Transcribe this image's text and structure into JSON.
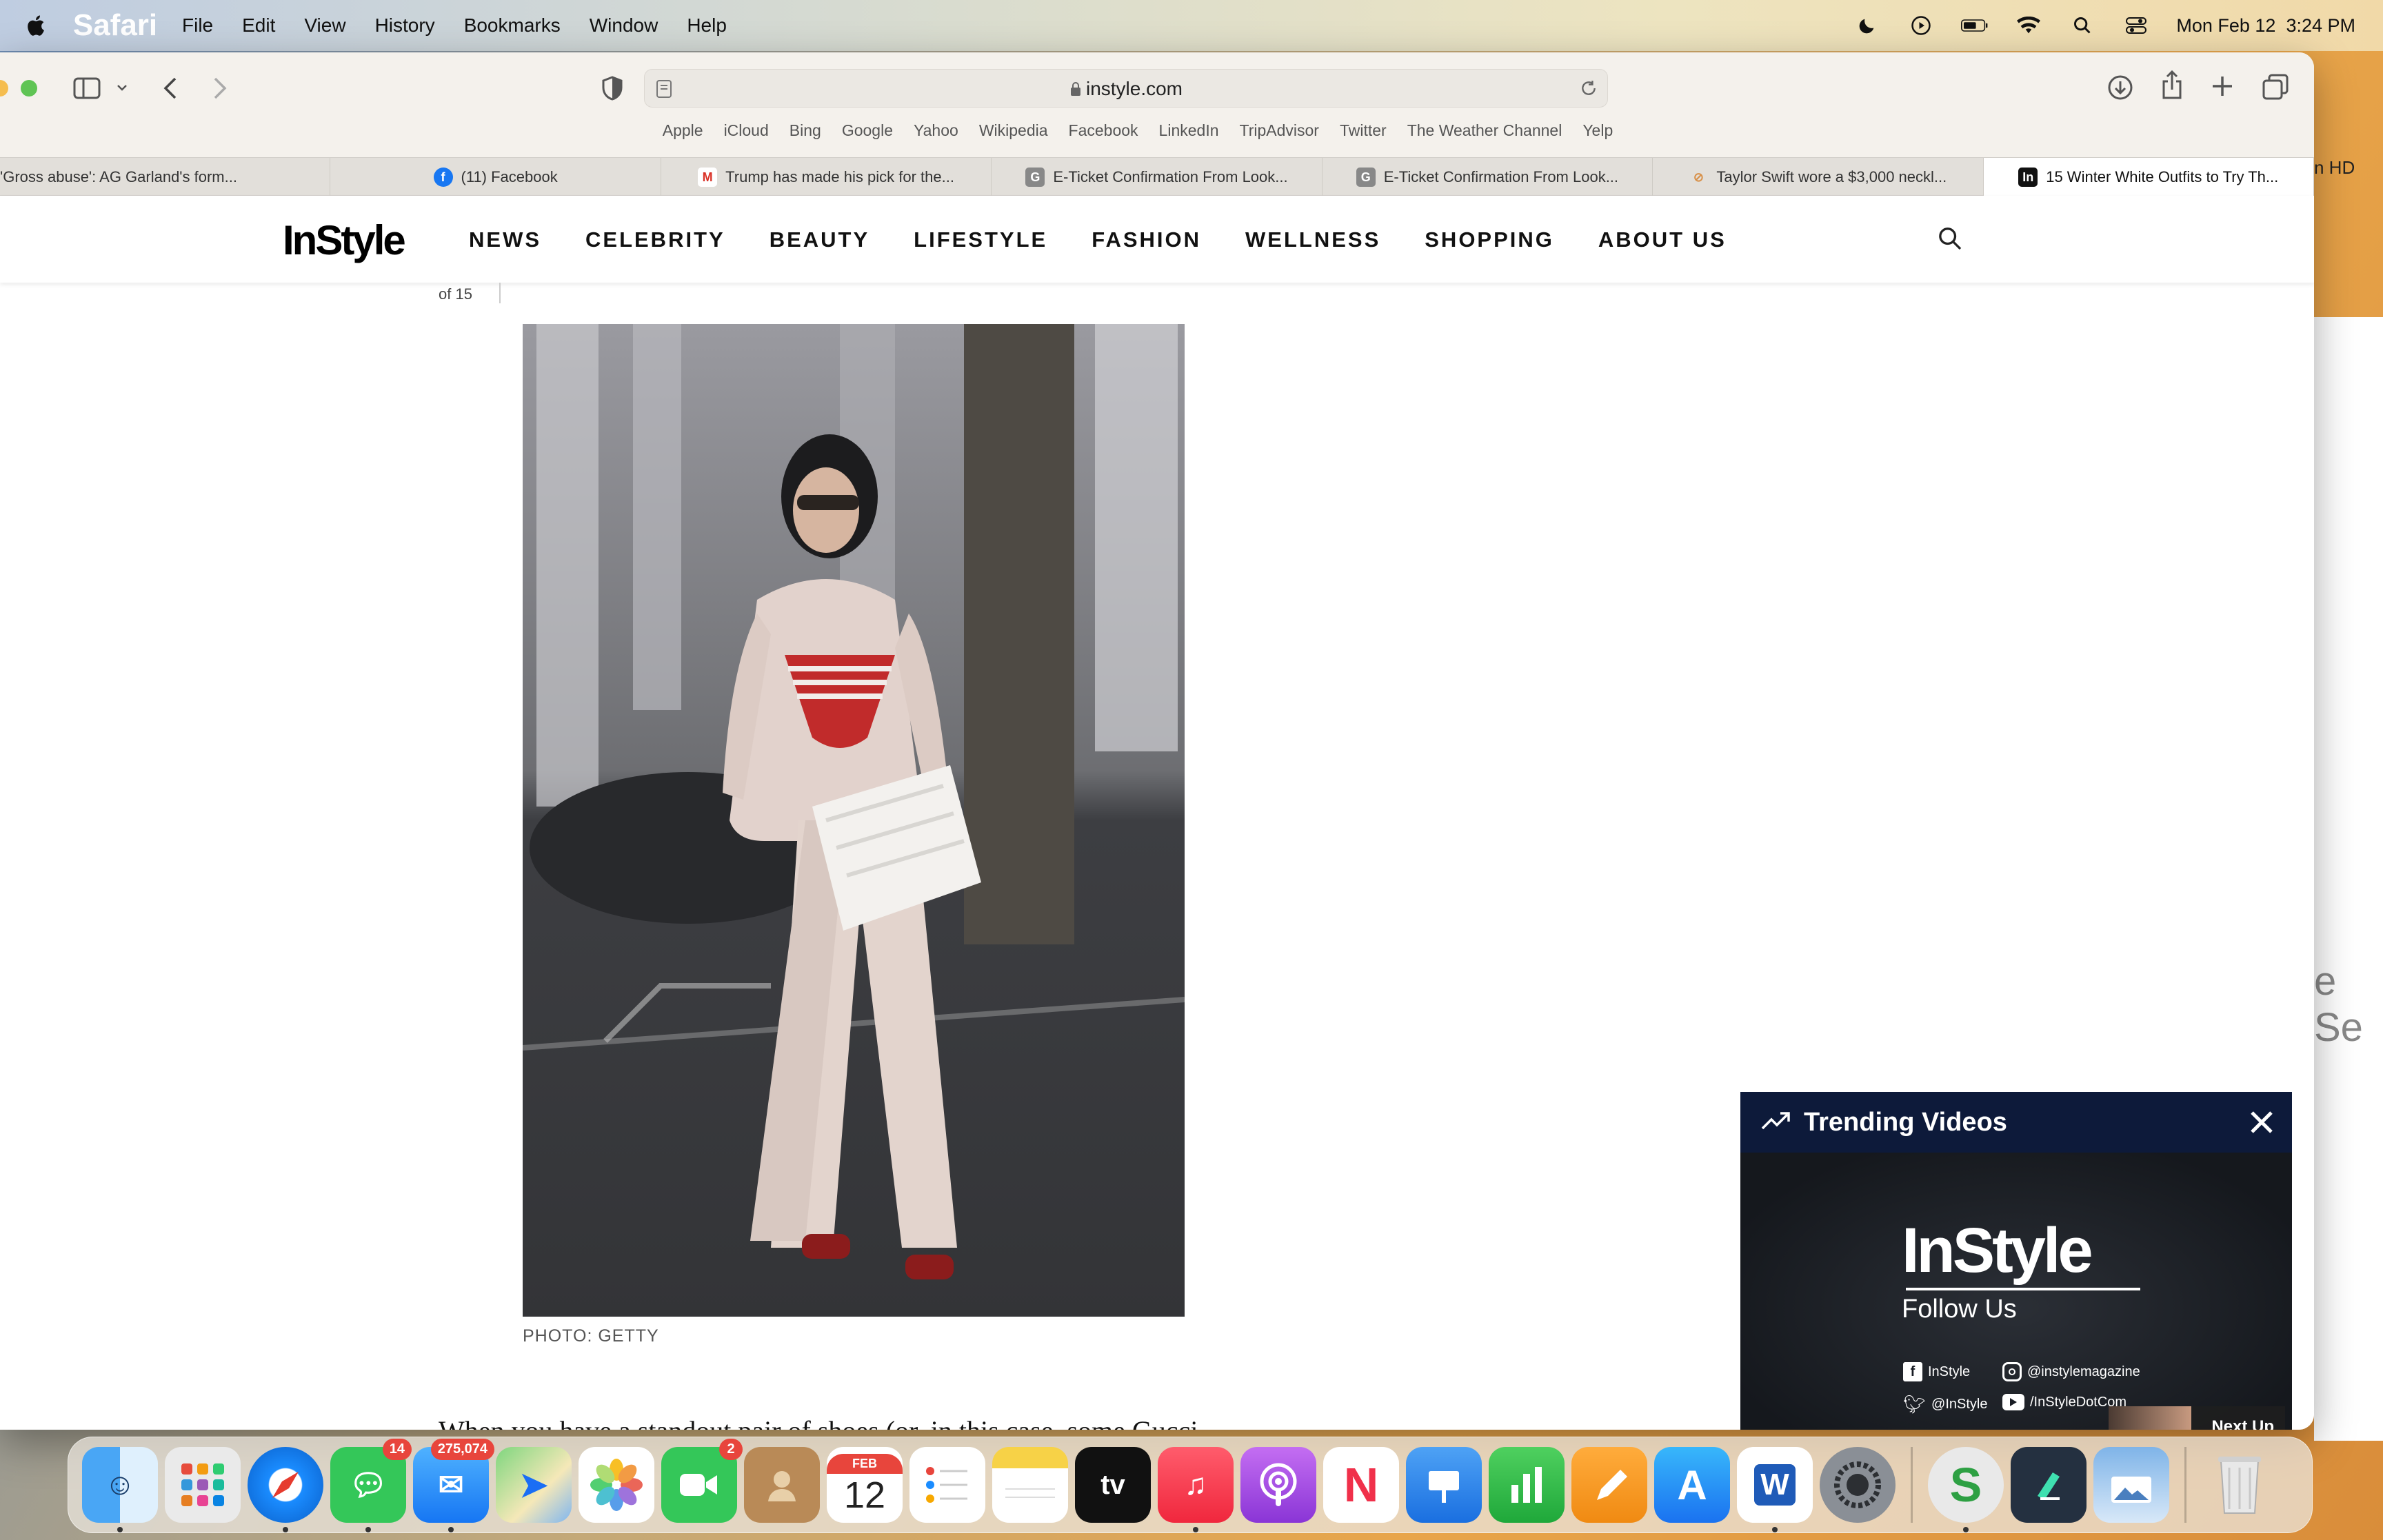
{
  "menubar": {
    "app_name": "Safari",
    "items": [
      "File",
      "Edit",
      "View",
      "History",
      "Bookmarks",
      "Window",
      "Help"
    ],
    "clock": "Mon Feb 12  3:24 PM"
  },
  "browser": {
    "url": "instyle.com",
    "favorites": [
      "Apple",
      "iCloud",
      "Bing",
      "Google",
      "Yahoo",
      "Wikipedia",
      "Facebook",
      "LinkedIn",
      "TripAdvisor",
      "Twitter",
      "The Weather Channel",
      "Yelp"
    ],
    "tabs": [
      {
        "label": "'Gross abuse': AG Garland's form...",
        "icon": "none"
      },
      {
        "label": "(11) Facebook",
        "icon": "facebook-icon"
      },
      {
        "label": "Trump has made his pick for the...",
        "icon": "gmail-icon"
      },
      {
        "label": "E-Ticket Confirmation From Look...",
        "icon": "g-icon"
      },
      {
        "label": "E-Ticket Confirmation From Look...",
        "icon": "g-icon"
      },
      {
        "label": "Taylor Swift wore a $3,000 neckl...",
        "icon": "leaf-icon"
      },
      {
        "label": "15 Winter White Outfits to Try Th...",
        "icon": "instyle-icon"
      }
    ]
  },
  "site": {
    "logo": "InStyle",
    "nav": [
      "NEWS",
      "CELEBRITY",
      "BEAUTY",
      "LIFESTYLE",
      "FASHION",
      "WELLNESS",
      "SHOPPING",
      "ABOUT US"
    ],
    "slide_count": "of 15",
    "caption": "PHOTO: GETTY",
    "body_text": "When you have a standout pair of shoes (or, in this case, some Gucci"
  },
  "video": {
    "title": "Trending Videos",
    "logo": "InStyle",
    "follow": "Follow Us",
    "socials": [
      {
        "icon": "facebook-icon",
        "handle": "InStyle"
      },
      {
        "icon": "instagram-icon",
        "handle": "@instylemagazine"
      },
      {
        "icon": "twitter-icon",
        "handle": "@InStyle"
      },
      {
        "icon": "youtube-icon",
        "handle": "/InStyleDotCom"
      }
    ],
    "next_up": "Next Up"
  },
  "desktop": {
    "label_hd": "n HD",
    "partial_text": "e Se"
  },
  "dock": {
    "messages_badge": "14",
    "mail_badge": "275,074",
    "facetime_badge": "2",
    "calendar_month": "FEB",
    "calendar_day": "12"
  }
}
